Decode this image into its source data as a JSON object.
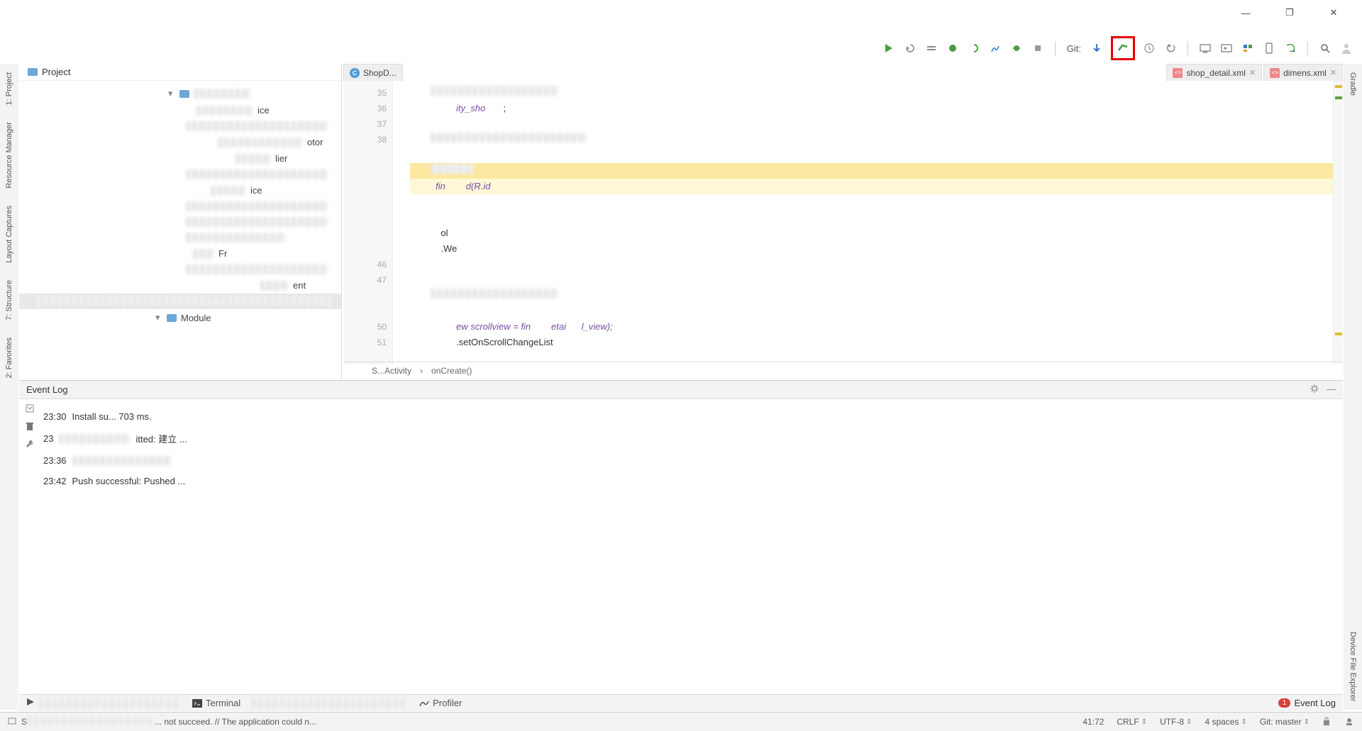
{
  "window_controls": {
    "minimize": "—",
    "maximize": "❐",
    "close": "✕"
  },
  "toolbar": {
    "git_label": "Git:"
  },
  "left_tabs": [
    "1: Project",
    "Resource Manager",
    "Layout Captures",
    "7: Structure",
    "2: Favorites"
  ],
  "right_tabs": [
    "Gradle",
    "Device File Explorer"
  ],
  "project": {
    "header": "Project",
    "items_visible": [
      "ice",
      "otor",
      "lier",
      "ice",
      "Fr",
      "ent",
      "Module"
    ]
  },
  "editor_tabs": [
    {
      "icon": "c",
      "label": "ShopD..."
    },
    {
      "icon": "xml",
      "label": "shop_detail.xml"
    },
    {
      "icon": "xml",
      "label": "dimens.xml"
    }
  ],
  "gutter_lines": [
    "35",
    "36",
    "37",
    "38",
    "",
    "",
    "",
    "",
    "",
    "",
    "",
    "46",
    "47",
    "",
    "",
    "50",
    "51"
  ],
  "code": {
    "l36": "ity_sho",
    "l_find": "fin        d(R.id",
    "l_ol": "ol",
    "l_we": ".We",
    "l50": "ew scrollview = fin        etai      l_view);",
    "l51": ".setOnScrollChangeList"
  },
  "breadcrumb": [
    "S...Activity",
    "onCreate()"
  ],
  "eventlog": {
    "title": "Event Log",
    "rows": [
      {
        "time": "23:30",
        "text": "Install su...            703 ms."
      },
      {
        "time": "23",
        "text": "itted: 建立 ..."
      },
      {
        "time": "23:36",
        "text": ""
      },
      {
        "time": "23:42",
        "text": "Push successful: Pushed ..."
      }
    ]
  },
  "bottom_tabs": {
    "terminal": "Terminal",
    "profiler": "Profiler",
    "event_log": "Event Log",
    "event_count": "1"
  },
  "statusbar": {
    "message": "... not succeed. // The application could n...",
    "position": "41:72",
    "line_sep": "CRLF",
    "encoding": "UTF-8",
    "indent": "4 spaces",
    "git_branch": "Git: master"
  }
}
